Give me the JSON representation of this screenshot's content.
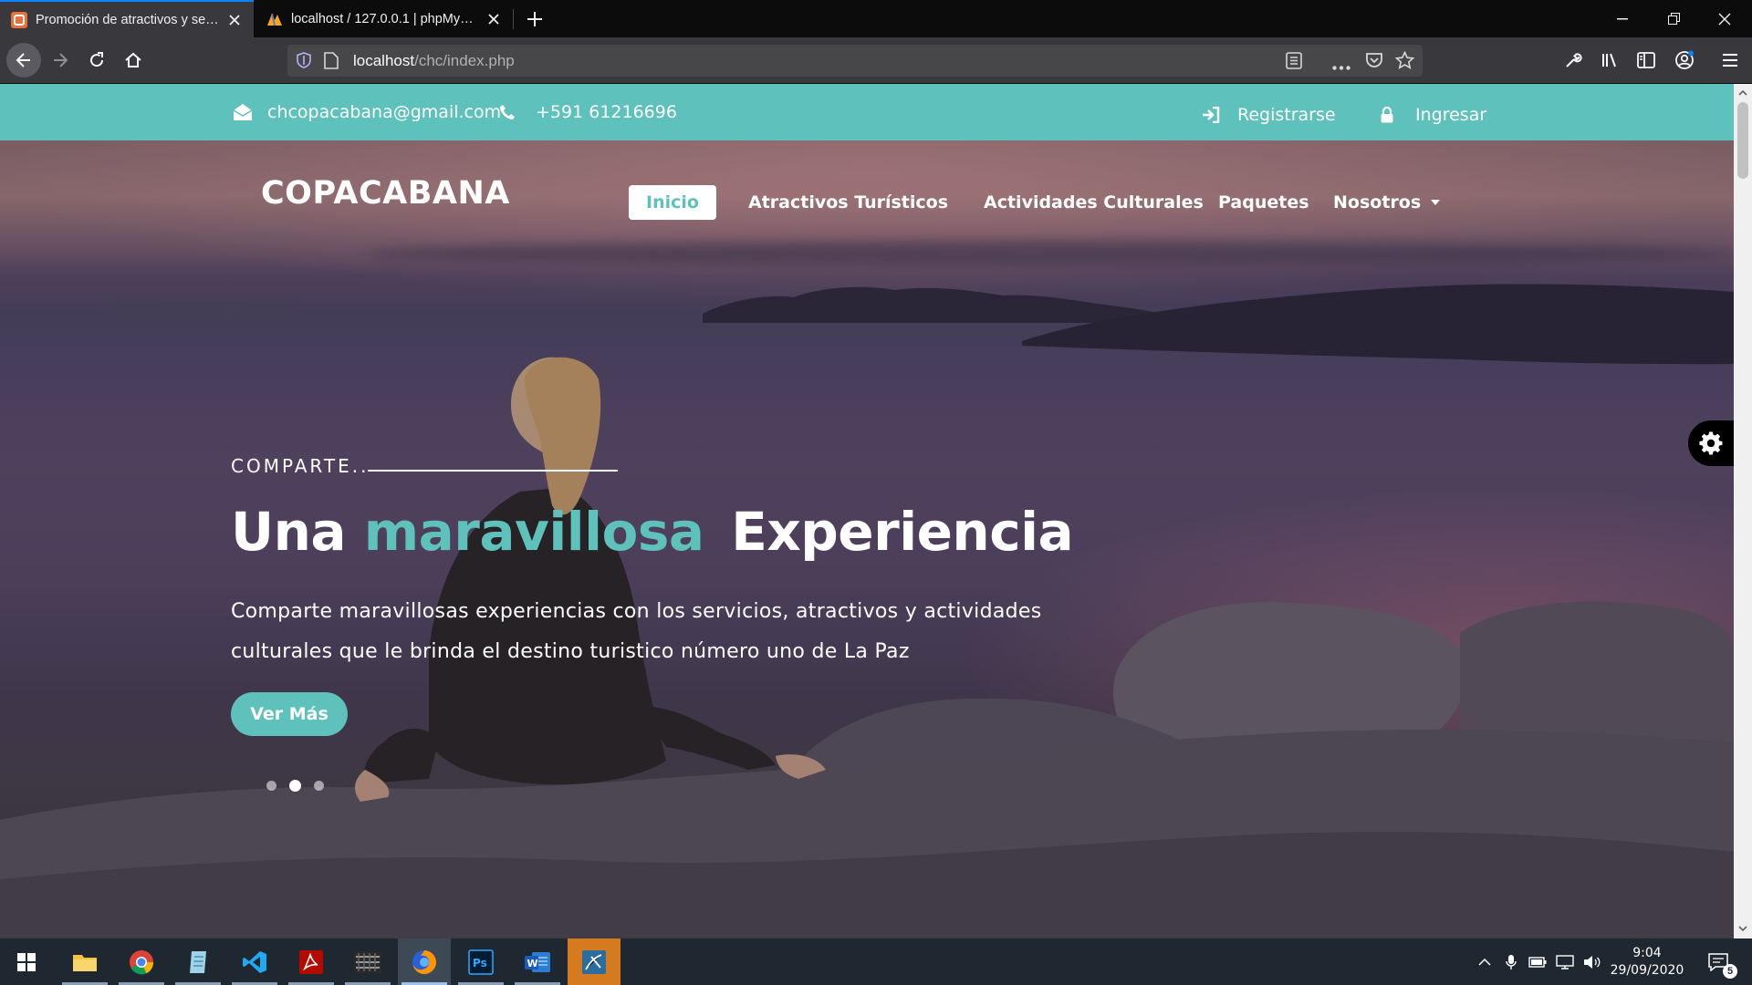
{
  "browser": {
    "tabs": [
      {
        "title": "Promoción de atractivos y servicios",
        "active": true
      },
      {
        "title": "localhost / 127.0.0.1 | phpMyAdmin",
        "active": false
      }
    ],
    "url": {
      "host": "localhost",
      "path": "/chc/index.php"
    }
  },
  "site": {
    "topbar": {
      "email": "chcopacabana@gmail.com",
      "phone": "+591 61216696",
      "register_label": "Registrarse",
      "login_label": "Ingresar"
    },
    "brand": "COPACABANA",
    "menu": [
      {
        "label": "Inicio",
        "active": true
      },
      {
        "label": "Atractivos Turísticos",
        "active": false
      },
      {
        "label": "Actividades Culturales",
        "active": false
      },
      {
        "label": "Paquetes",
        "active": false
      },
      {
        "label": "Nosotros",
        "active": false,
        "dropdown": true
      }
    ],
    "hero": {
      "kicker": "COMPARTE..",
      "headline_start": "Una",
      "headline_accent": "maravillosa",
      "headline_end": "Experiencia",
      "subtitle": "Comparte maravillosas experiencias con los servicios, atractivos y actividades culturales que le brinda el destino turistico número uno de La Paz",
      "cta_label": "Ver Más",
      "slides": 3,
      "active_slide": 2
    },
    "colors": {
      "accent": "#5fc1bb",
      "topbar_bg": "#5fc1bb"
    }
  },
  "taskbar": {
    "apps": [
      "windows-start",
      "file-explorer",
      "chrome",
      "notepad",
      "vscode",
      "acrobat",
      "game-app",
      "firefox",
      "photoshop",
      "word",
      "mysql-workbench"
    ],
    "time": "9:04",
    "date": "29/09/2020",
    "notifications": "5"
  }
}
